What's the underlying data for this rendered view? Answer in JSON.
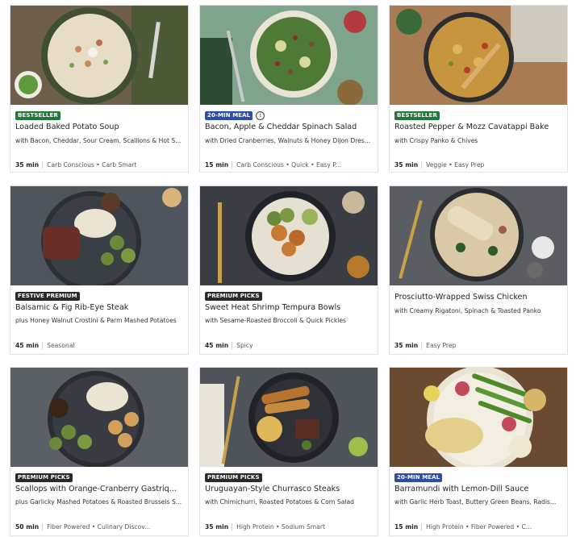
{
  "recipes": [
    {
      "badge": "BESTSELLER",
      "badge_color": "#1f7a3a",
      "title": "Loaded Baked Potato Soup",
      "subtitle": "with Bacon, Cheddar, Sour Cream, Scallions & Hot S...",
      "time": "35 min",
      "tags": "Carb Conscious • Carb Smart"
    },
    {
      "badge": "20-MIN MEAL",
      "badge_color": "#2d4ea8",
      "title": "Bacon, Apple & Cheddar Spinach Salad",
      "subtitle": "with Dried Cranberries, Walnuts & Honey Dijon Dres...",
      "time": "15 min",
      "tags": "Carb Conscious • Quick • Easy P..."
    },
    {
      "badge": "BESTSELLER",
      "badge_color": "#1f7a3a",
      "title": "Roasted Pepper & Mozz Cavatappi Bake",
      "subtitle": "with Crispy Panko & Chives",
      "time": "35 min",
      "tags": "Veggie • Easy Prep"
    },
    {
      "badge": "FESTIVE PREMIUM",
      "badge_color": "#2a2a2a",
      "title": "Balsamic & Fig Rib-Eye Steak",
      "subtitle": "plus Honey Walnut Crostini & Parm Mashed Potatoes",
      "time": "45 min",
      "tags": "Seasonal"
    },
    {
      "badge": "PREMIUM PICKS",
      "badge_color": "#2a2a2a",
      "title": "Sweet Heat Shrimp Tempura Bowls",
      "subtitle": "with Sesame-Roasted Broccoli & Quick Pickles",
      "time": "45 min",
      "tags": "Spicy"
    },
    {
      "badge": "",
      "badge_color": "",
      "title": "Prosciutto-Wrapped Swiss Chicken",
      "subtitle": "with Creamy Rigatoni, Spinach & Toasted Panko",
      "time": "35 min",
      "tags": "Easy Prep"
    },
    {
      "badge": "PREMIUM PICKS",
      "badge_color": "#2a2a2a",
      "title": "Scallops with Orange-Cranberry Gastriq...",
      "subtitle": "plus Garlicky Mashed Potatoes & Roasted Brussels S...",
      "time": "50 min",
      "tags": "Fiber Powered • Culinary Discov..."
    },
    {
      "badge": "PREMIUM PICKS",
      "badge_color": "#2a2a2a",
      "title": "Uruguayan-Style Churrasco Steaks",
      "subtitle": "with Chimichurri, Roasted Potatoes & Corn Salad",
      "time": "35 min",
      "tags": "High Protein • Sodium Smart"
    },
    {
      "badge": "20-MIN MEAL",
      "badge_color": "#2d4ea8",
      "title": "Barramundi with Lemon-Dill Sauce",
      "subtitle": "with Garlic Herb Toast, Buttery Green Beans, Radis...",
      "time": "15 min",
      "tags": "High Protein • Fiber Powered • C..."
    }
  ]
}
